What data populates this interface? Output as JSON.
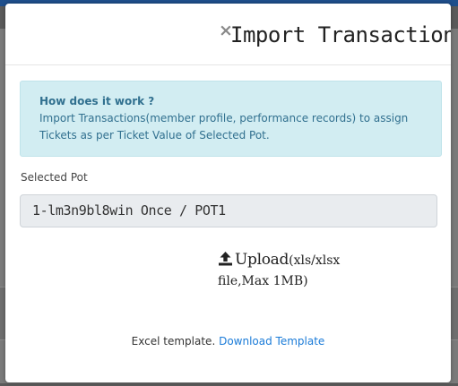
{
  "modal": {
    "close_symbol": "×",
    "title": "Import Transactions"
  },
  "info": {
    "heading": "How does it work ?",
    "body": "Import Transactions(member profile, performance records) to assign Tickets as per Ticket Value of Selected Pot."
  },
  "selected_pot": {
    "label": "Selected Pot",
    "value": "1-lm3n9bl8win Once / POT1"
  },
  "upload": {
    "icon": "upload-icon",
    "label": "Upload",
    "hint": "(xls/xlsx file,Max 1MB)"
  },
  "template": {
    "prefix": "Excel template.",
    "link_text": "Download Template"
  },
  "colors": {
    "info_bg": "#d2edf2",
    "info_text": "#31708f",
    "link": "#1a7bd8",
    "field_bg": "#e9ecef"
  }
}
